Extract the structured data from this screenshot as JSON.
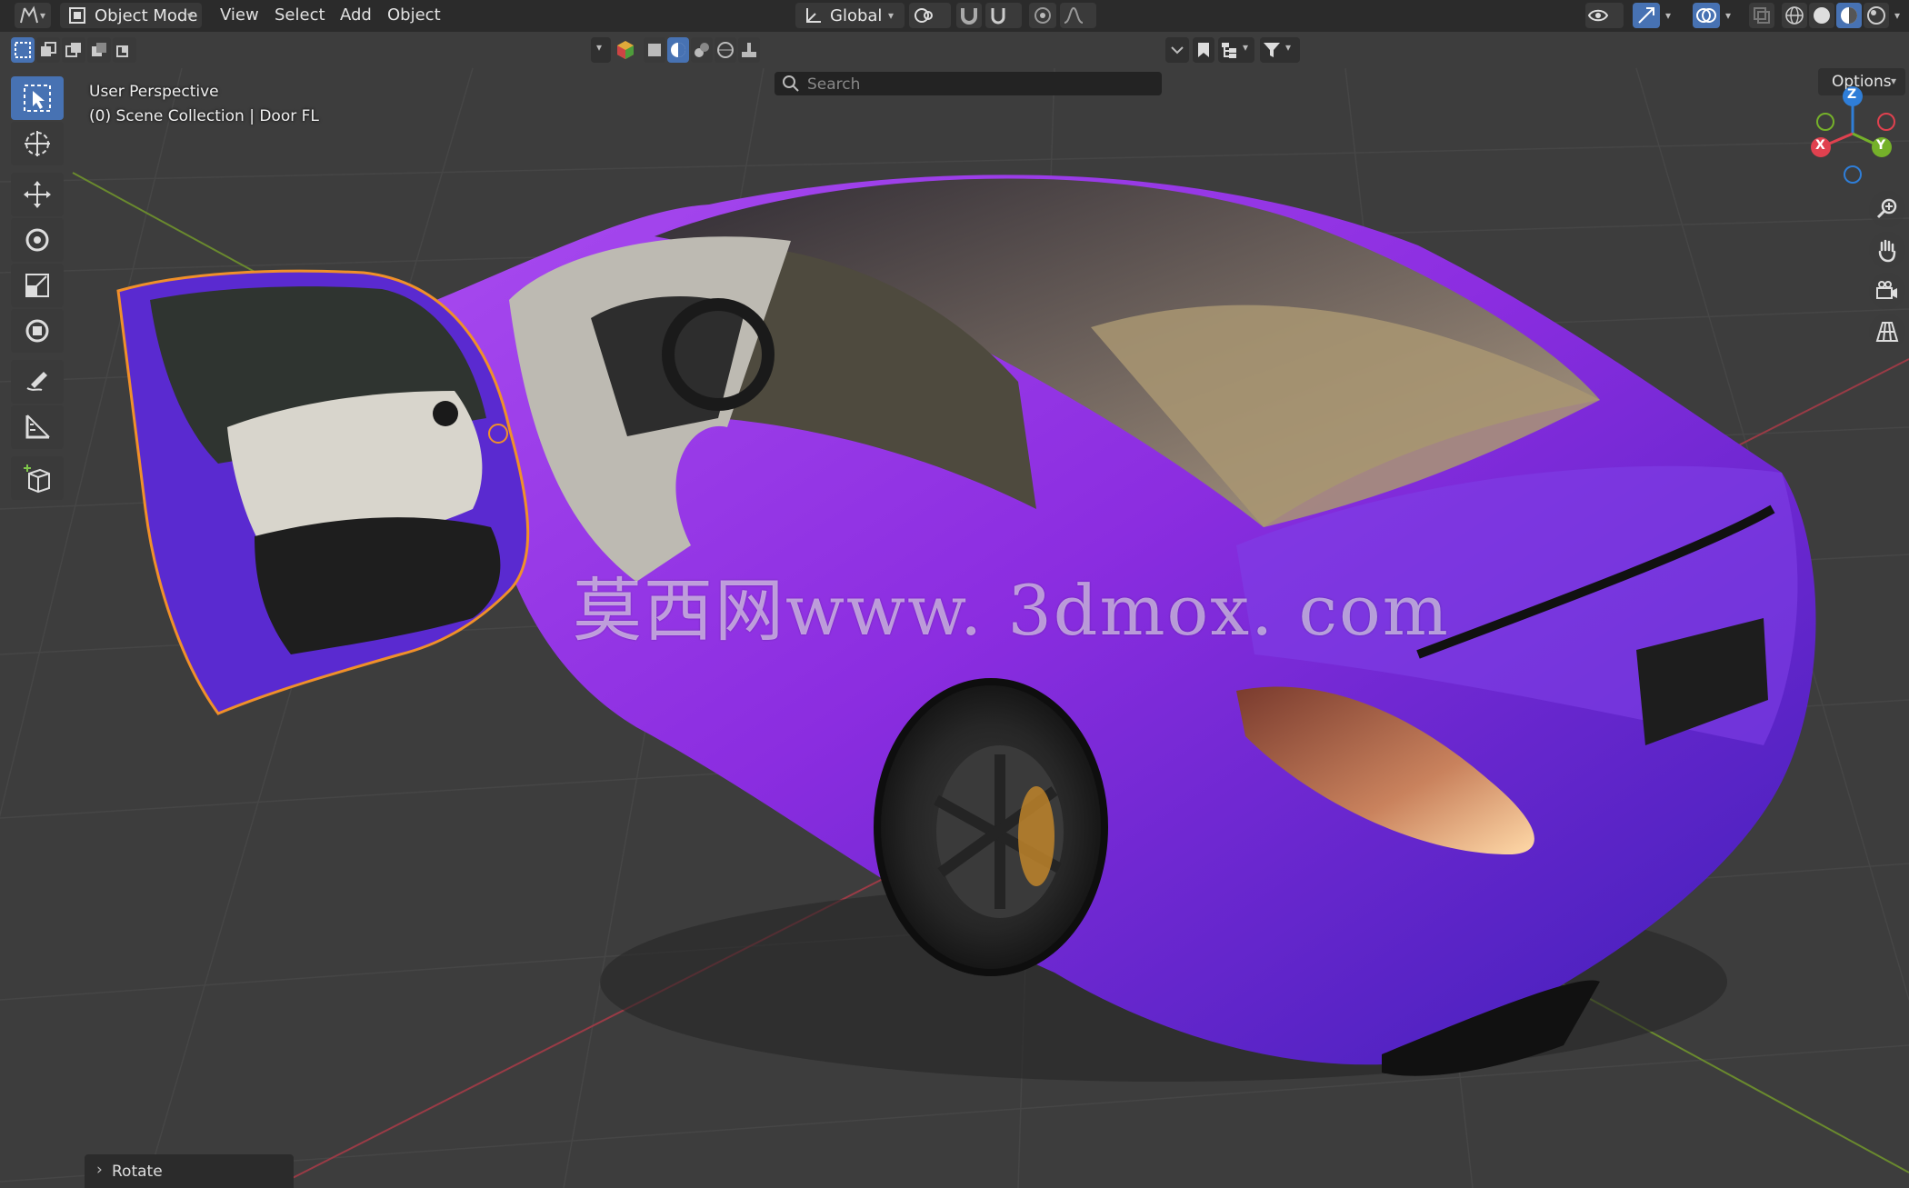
{
  "header": {
    "menu": [
      "View",
      "Select",
      "Add",
      "Object"
    ],
    "mode": "Object Mode",
    "transform_orientation": "Global"
  },
  "subheader": {
    "search_placeholder": "Search",
    "options_label": "Options"
  },
  "viewport": {
    "view_name": "User Perspective",
    "collection_info": "(0) Scene Collection | Door FL",
    "watermark": "莫西网www. 3dmox. com"
  },
  "gizmo": {
    "z": "Z",
    "x": "X",
    "y": "Y"
  },
  "operator_panel": {
    "label": "Rotate"
  },
  "tools": [
    "select-box",
    "cursor",
    "move",
    "rotate",
    "scale",
    "transform",
    "annotate",
    "measure",
    "add-cube"
  ],
  "colors": {
    "accent": "#4772b3",
    "header_bg": "#2b2b2b",
    "viewport_bg": "#3d3d3d",
    "selection_outline": "#f0902a",
    "car_paint": "#8a2be2",
    "axis_x": "#e0414f",
    "axis_y": "#75b12a",
    "axis_z": "#2f7ed8"
  }
}
